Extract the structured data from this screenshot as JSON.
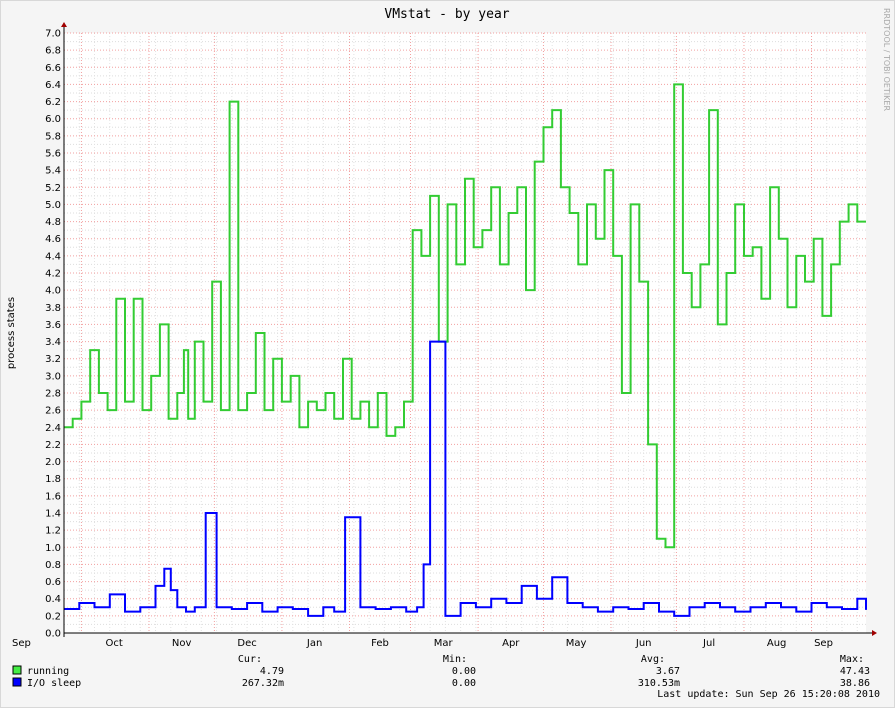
{
  "chart_data": {
    "type": "line",
    "title": "VMstat - by year",
    "ylabel": "process states",
    "watermark": "RRDTOOL / TOBI OETIKER",
    "ylim": [
      0,
      7.0
    ],
    "yticks": [
      "0.0",
      "0.2",
      "0.4",
      "0.6",
      "0.8",
      "1.0",
      "1.2",
      "1.4",
      "1.6",
      "1.8",
      "2.0",
      "2.2",
      "2.4",
      "2.6",
      "2.8",
      "3.0",
      "3.2",
      "3.4",
      "3.6",
      "3.8",
      "4.0",
      "4.2",
      "4.4",
      "4.6",
      "4.8",
      "5.0",
      "5.2",
      "5.4",
      "5.6",
      "5.8",
      "6.0",
      "6.2",
      "6.4",
      "6.6",
      "6.8",
      "7.0"
    ],
    "x_start": "2009-09-23",
    "x_end": "2010-09-26",
    "months": [
      {
        "label": "Sep",
        "start": "2009-09-01",
        "end": "2009-10-01"
      },
      {
        "label": "Oct",
        "start": "2009-10-01",
        "end": "2009-11-01"
      },
      {
        "label": "Nov",
        "start": "2009-11-01",
        "end": "2009-12-01"
      },
      {
        "label": "Dec",
        "start": "2009-12-01",
        "end": "2010-01-01"
      },
      {
        "label": "Jan",
        "start": "2010-01-01",
        "end": "2010-02-01"
      },
      {
        "label": "Feb",
        "start": "2010-02-01",
        "end": "2010-03-01"
      },
      {
        "label": "Mar",
        "start": "2010-03-01",
        "end": "2010-04-01"
      },
      {
        "label": "Apr",
        "start": "2010-04-01",
        "end": "2010-05-01"
      },
      {
        "label": "May",
        "start": "2010-05-01",
        "end": "2010-06-01"
      },
      {
        "label": "Jun",
        "start": "2010-06-01",
        "end": "2010-07-01"
      },
      {
        "label": "Jul",
        "start": "2010-07-01",
        "end": "2010-08-01"
      },
      {
        "label": "Aug",
        "start": "2010-08-01",
        "end": "2010-09-01"
      },
      {
        "label": "Sep",
        "start": "2010-09-01",
        "end": "2010-09-26"
      }
    ],
    "grid": true,
    "series": [
      {
        "name": "running",
        "color": "#44ee44",
        "stroke": "#33cc33",
        "x": [
          "2009-09-23",
          "2009-09-27",
          "2009-10-01",
          "2009-10-05",
          "2009-10-09",
          "2009-10-13",
          "2009-10-17",
          "2009-10-21",
          "2009-10-25",
          "2009-10-29",
          "2009-11-02",
          "2009-11-06",
          "2009-11-10",
          "2009-11-14",
          "2009-11-17",
          "2009-11-19",
          "2009-11-22",
          "2009-11-26",
          "2009-11-30",
          "2009-12-04",
          "2009-12-08",
          "2009-12-12",
          "2009-12-16",
          "2009-12-20",
          "2009-12-24",
          "2009-12-28",
          "2010-01-01",
          "2010-01-05",
          "2010-01-09",
          "2010-01-13",
          "2010-01-17",
          "2010-01-21",
          "2010-01-25",
          "2010-01-29",
          "2010-02-02",
          "2010-02-06",
          "2010-02-10",
          "2010-02-14",
          "2010-02-18",
          "2010-02-22",
          "2010-02-26",
          "2010-03-02",
          "2010-03-06",
          "2010-03-10",
          "2010-03-14",
          "2010-03-18",
          "2010-03-22",
          "2010-03-26",
          "2010-03-30",
          "2010-04-03",
          "2010-04-07",
          "2010-04-11",
          "2010-04-15",
          "2010-04-19",
          "2010-04-23",
          "2010-04-27",
          "2010-05-01",
          "2010-05-05",
          "2010-05-09",
          "2010-05-13",
          "2010-05-17",
          "2010-05-21",
          "2010-05-25",
          "2010-05-29",
          "2010-06-02",
          "2010-06-06",
          "2010-06-10",
          "2010-06-14",
          "2010-06-18",
          "2010-06-22",
          "2010-06-26",
          "2010-06-30",
          "2010-07-04",
          "2010-07-08",
          "2010-07-12",
          "2010-07-16",
          "2010-07-20",
          "2010-07-24",
          "2010-07-28",
          "2010-08-01",
          "2010-08-05",
          "2010-08-09",
          "2010-08-13",
          "2010-08-17",
          "2010-08-21",
          "2010-08-25",
          "2010-08-29",
          "2010-09-02",
          "2010-09-06",
          "2010-09-10",
          "2010-09-14",
          "2010-09-18",
          "2010-09-22",
          "2010-09-26"
        ],
        "values": [
          2.4,
          2.5,
          2.7,
          3.3,
          2.8,
          2.6,
          3.9,
          2.7,
          3.9,
          2.6,
          3.0,
          3.6,
          2.5,
          2.8,
          3.3,
          2.5,
          3.4,
          2.7,
          4.1,
          2.6,
          6.2,
          2.6,
          2.8,
          3.5,
          2.6,
          3.2,
          2.7,
          3.0,
          2.4,
          2.7,
          2.6,
          2.8,
          2.5,
          3.2,
          2.5,
          2.7,
          2.4,
          2.8,
          2.3,
          2.4,
          2.7,
          4.7,
          4.4,
          5.1,
          3.4,
          5.0,
          4.3,
          5.3,
          4.5,
          4.7,
          5.2,
          4.3,
          4.9,
          5.2,
          4.0,
          5.5,
          5.9,
          6.1,
          5.2,
          4.9,
          4.3,
          5.0,
          4.6,
          5.4,
          4.4,
          2.8,
          5.0,
          4.1,
          2.2,
          1.1,
          1.0,
          6.4,
          4.2,
          3.8,
          4.3,
          6.1,
          3.6,
          4.2,
          5.0,
          4.4,
          4.5,
          3.9,
          5.2,
          4.6,
          3.8,
          4.4,
          4.1,
          4.6,
          3.7,
          4.3,
          4.8,
          5.0,
          4.8,
          4.8
        ]
      },
      {
        "name": "I/O sleep",
        "color": "#0000ff",
        "stroke": "#0000ff",
        "x": [
          "2009-09-23",
          "2009-09-30",
          "2009-10-07",
          "2009-10-14",
          "2009-10-21",
          "2009-10-28",
          "2009-11-04",
          "2009-11-08",
          "2009-11-11",
          "2009-11-14",
          "2009-11-18",
          "2009-11-22",
          "2009-11-27",
          "2009-12-02",
          "2009-12-09",
          "2009-12-16",
          "2009-12-23",
          "2009-12-30",
          "2010-01-06",
          "2010-01-13",
          "2010-01-20",
          "2010-01-25",
          "2010-01-30",
          "2010-02-06",
          "2010-02-13",
          "2010-02-20",
          "2010-02-27",
          "2010-03-04",
          "2010-03-07",
          "2010-03-10",
          "2010-03-17",
          "2010-03-24",
          "2010-03-31",
          "2010-04-07",
          "2010-04-14",
          "2010-04-21",
          "2010-04-28",
          "2010-05-05",
          "2010-05-12",
          "2010-05-19",
          "2010-05-26",
          "2010-06-02",
          "2010-06-09",
          "2010-06-16",
          "2010-06-23",
          "2010-06-30",
          "2010-07-07",
          "2010-07-14",
          "2010-07-21",
          "2010-07-28",
          "2010-08-04",
          "2010-08-11",
          "2010-08-18",
          "2010-08-25",
          "2010-09-01",
          "2010-09-08",
          "2010-09-15",
          "2010-09-22",
          "2010-09-26"
        ],
        "values": [
          0.28,
          0.35,
          0.3,
          0.45,
          0.25,
          0.3,
          0.55,
          0.75,
          0.5,
          0.3,
          0.25,
          0.3,
          1.4,
          0.3,
          0.28,
          0.35,
          0.25,
          0.3,
          0.28,
          0.2,
          0.3,
          0.25,
          1.35,
          0.3,
          0.28,
          0.3,
          0.25,
          0.3,
          0.8,
          3.4,
          0.2,
          0.35,
          0.3,
          0.4,
          0.35,
          0.55,
          0.4,
          0.65,
          0.35,
          0.3,
          0.25,
          0.3,
          0.28,
          0.35,
          0.25,
          0.2,
          0.3,
          0.35,
          0.3,
          0.25,
          0.3,
          0.35,
          0.3,
          0.25,
          0.35,
          0.3,
          0.28,
          0.4,
          0.27
        ]
      }
    ],
    "stats_headers": [
      "Cur:",
      "Min:",
      "Avg:",
      "Max:"
    ],
    "stats": [
      {
        "name": "running",
        "cur": "4.79",
        "min": "0.00",
        "avg": "3.67",
        "max": "47.43"
      },
      {
        "name": "I/O sleep",
        "cur": "267.32m",
        "min": "0.00",
        "avg": "310.53m",
        "max": "38.86"
      }
    ],
    "last_update": "Last update: Sun Sep 26 15:20:08 2010"
  }
}
